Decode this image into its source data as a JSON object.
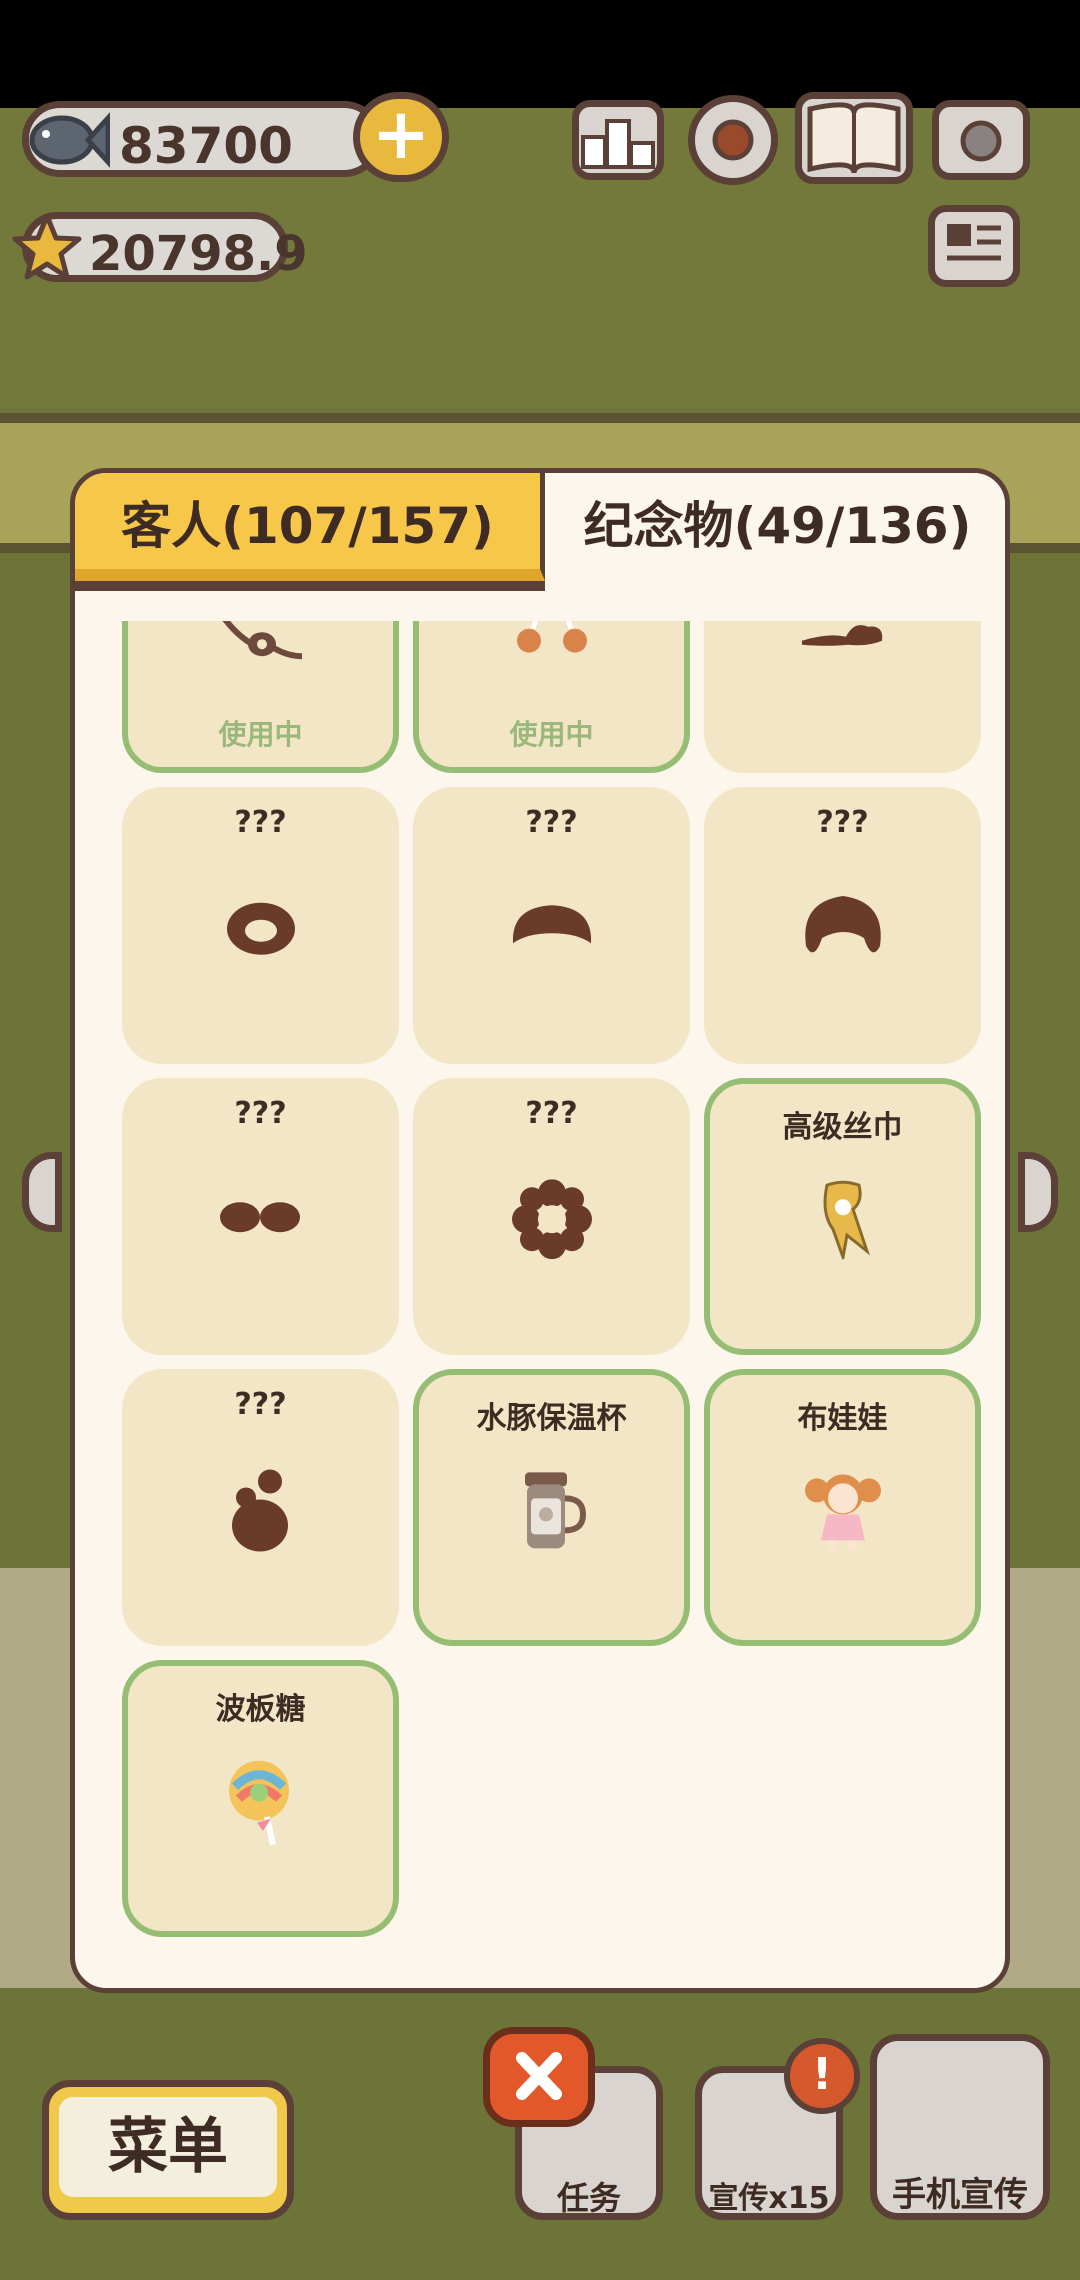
{
  "hud": {
    "fish_count": "83700",
    "star_count": "20798.9"
  },
  "dialog": {
    "tabs": [
      {
        "label": "客人(107/157)",
        "active": false
      },
      {
        "label": "纪念物(49/136)",
        "active": true
      }
    ],
    "items": [
      {
        "name": "",
        "status": "使用中",
        "owned": true,
        "icon": "eyepatch-icon"
      },
      {
        "name": "",
        "status": "使用中",
        "owned": true,
        "icon": "drumstick-earrings-icon"
      },
      {
        "name": "",
        "status": "",
        "owned": false,
        "icon": "locked-silhouette-icon"
      },
      {
        "name": "???",
        "status": "",
        "owned": false,
        "icon": "locked-silhouette-icon"
      },
      {
        "name": "???",
        "status": "",
        "owned": false,
        "icon": "locked-silhouette-icon"
      },
      {
        "name": "???",
        "status": "",
        "owned": false,
        "icon": "locked-silhouette-icon"
      },
      {
        "name": "???",
        "status": "",
        "owned": false,
        "icon": "locked-silhouette-icon"
      },
      {
        "name": "???",
        "status": "",
        "owned": false,
        "icon": "locked-silhouette-icon"
      },
      {
        "name": "高级丝巾",
        "status": "",
        "owned": true,
        "icon": "silk-scarf-icon"
      },
      {
        "name": "???",
        "status": "",
        "owned": false,
        "icon": "locked-silhouette-icon"
      },
      {
        "name": "水豚保温杯",
        "status": "",
        "owned": true,
        "icon": "thermos-cup-icon"
      },
      {
        "name": "布娃娃",
        "status": "",
        "owned": true,
        "icon": "rag-doll-icon"
      },
      {
        "name": "波板糖",
        "status": "",
        "owned": true,
        "icon": "lollipop-icon"
      }
    ]
  },
  "bottom_bar": {
    "menu_label": "菜单",
    "task_label": "任务",
    "promo_label": "宣传x15",
    "phone_promo_label": "手机宣传",
    "alert_mark": "!"
  },
  "colors": {
    "panel_bg": "#fcf6ec",
    "card_bg": "#f3e6c6",
    "owned_border": "#96bd74",
    "active_tab": "#f7c74a",
    "outline": "#5a4036"
  }
}
